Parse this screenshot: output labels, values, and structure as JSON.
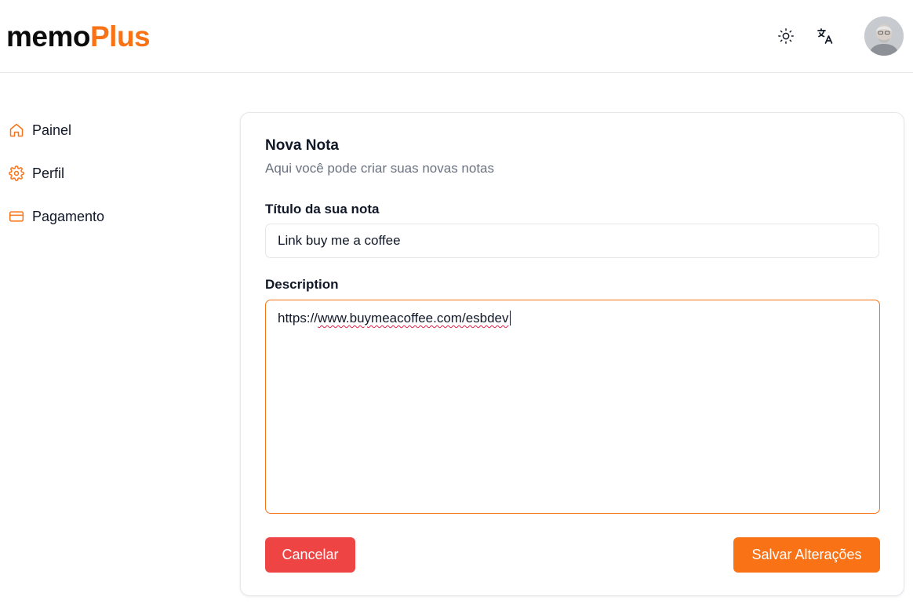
{
  "brand": {
    "part1": "memo",
    "part2": "Plus"
  },
  "header": {
    "theme_icon": "sun-icon",
    "language_icon": "translate-icon",
    "avatar": "user-avatar"
  },
  "sidebar": {
    "items": [
      {
        "label": "Painel",
        "icon": "home-icon"
      },
      {
        "label": "Perfil",
        "icon": "gear-icon"
      },
      {
        "label": "Pagamento",
        "icon": "credit-card-icon"
      }
    ]
  },
  "form": {
    "title": "Nova Nota",
    "subtitle": "Aqui você pode criar suas novas notas",
    "title_label": "Título da sua nota",
    "title_value": "Link buy me a coffee",
    "description_label": "Description",
    "description_prefix": "https://",
    "description_misspelled": "www.buymeacoffee.com/esbdev",
    "cancel_label": "Cancelar",
    "save_label": "Salvar Alterações"
  },
  "colors": {
    "accent": "#f97316",
    "danger": "#ef4444"
  }
}
